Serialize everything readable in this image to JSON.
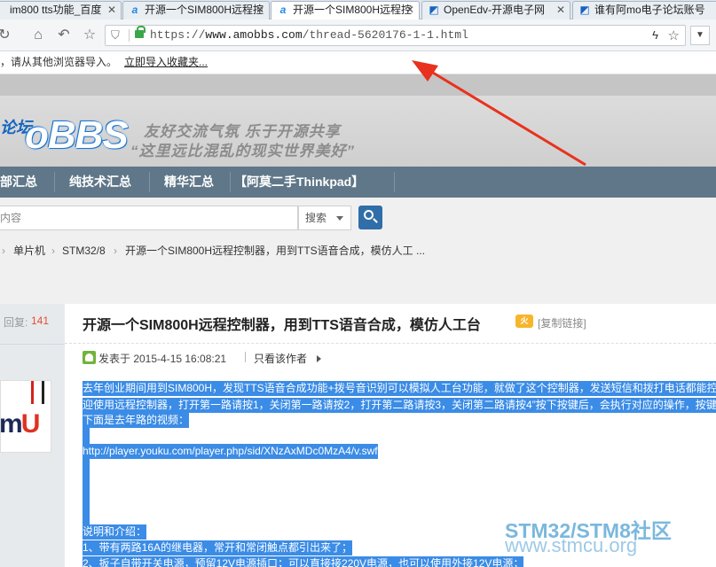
{
  "tabs": [
    {
      "label": "im800 tts功能_百度",
      "icon": "baidu-paw-icon",
      "close": "✕"
    },
    {
      "label": "开源一个SIM800H远程控",
      "icon": "amobbs-icon",
      "close": "✕"
    },
    {
      "label": "开源一个SIM800H远程控",
      "icon": "amobbs-icon",
      "close": "✕"
    },
    {
      "label": "OpenEdv-开源电子网",
      "icon": "openedv-icon",
      "close": "✕"
    },
    {
      "label": "谁有阿mo电子论坛账号",
      "icon": "amobbs-icon",
      "close": ""
    }
  ],
  "address": {
    "scheme": "https://",
    "host": "www.amobbs.com",
    "path": "/thread-5620176-1-1.html"
  },
  "favbar": {
    "message": "，请从其他浏览器导入。",
    "link": "立即导入收藏夹..."
  },
  "banner": {
    "logo_cn": "论坛",
    "logo_bbs": "oBBS",
    "slogan1": "友好交流气氛  乐于开源共享",
    "slogan2": "“这里远比混乱的现实世界美好”"
  },
  "mainnav": [
    "部汇总",
    "纯技术汇总",
    "精华汇总",
    "【阿莫二手Thinkpad】"
  ],
  "search": {
    "placeholder": "内容",
    "select_label": "搜索"
  },
  "breadcrumb": [
    "单片机",
    "STM32/8",
    "开源一个SIM800H远程控制器，用到TTS语音合成，模仿人工 ..."
  ],
  "thread": {
    "reply_label": "回复:",
    "reply_count": "141",
    "title": "开源一个SIM800H远程控制器，用到TTS语音合成，模仿人工台",
    "hot_badge": "火",
    "copy_link": "[复制链接]",
    "posted": "发表于 2015-4-15 16:08:21",
    "author_only": "只看该作者"
  },
  "post_lines": [
    "去年创业期间用到SIM800H，发现TTS语音合成功能+拨号音识别可以模拟人工台功能，就做了这个控制器，发送短信和拨打电话都能控",
    "迎使用远程控制器，打开第一路请按1，关闭第一路请按2，打开第二路请按3，关闭第二路请按4”按下按键后，会执行对应的操作，按键",
    "下面是去年路的视频：",
    "http://player.youku.com/player.php/sid/XNzAxMDc0MzA4/v.swf",
    "说明和介绍：",
    "1、带有两路16A的继电器，常开和常闭触点都引出来了；",
    "2、扳子自带开关电源，预留12V电源插口；可以直接接220V电源，也可以使用外接12V电源；"
  ],
  "avatar_text": {
    "m": "m",
    "u": "U"
  },
  "watermark": {
    "line1": "STM32/STM8社区",
    "line2": "www.stmcu.org"
  },
  "colors": {
    "selection": "#3b8ce6",
    "nav_bg": "#5f7788",
    "arrow": "#e8321e",
    "reply_count": "#e54d2e"
  }
}
